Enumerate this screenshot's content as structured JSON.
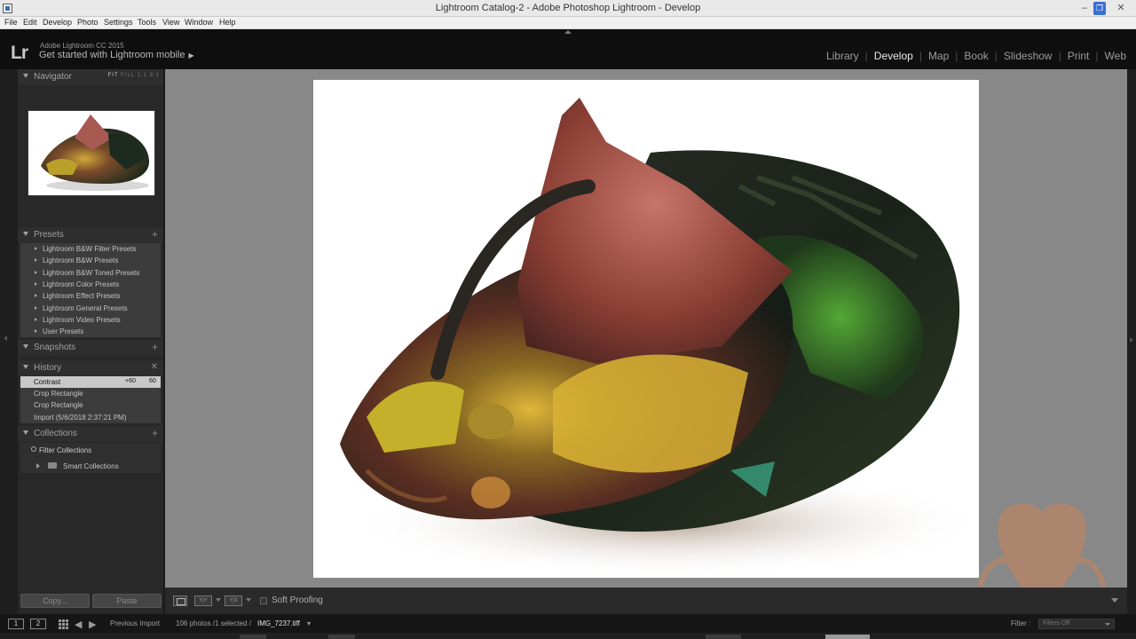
{
  "window": {
    "title": "Lightroom Catalog-2 - Adobe Photoshop Lightroom - Develop",
    "minimize": "–",
    "maximize": "❐",
    "close": "✕"
  },
  "menu": [
    "File",
    "Edit",
    "Develop",
    "Photo",
    "Settings",
    "Tools",
    "View",
    "Window",
    "Help"
  ],
  "identity": {
    "logo": "Lr",
    "version": "Adobe Lightroom CC 2015",
    "mobile_prompt": "Get started with Lightroom mobile",
    "mobile_arrow": "▶"
  },
  "modules": [
    {
      "label": "Library",
      "active": false
    },
    {
      "label": "Develop",
      "active": true
    },
    {
      "label": "Map",
      "active": false
    },
    {
      "label": "Book",
      "active": false
    },
    {
      "label": "Slideshow",
      "active": false
    },
    {
      "label": "Print",
      "active": false
    },
    {
      "label": "Web",
      "active": false
    }
  ],
  "navigator": {
    "title": "Navigator",
    "modes": [
      "FIT",
      "FILL",
      "1:1",
      "3:1"
    ],
    "active_mode": "FIT"
  },
  "presets": {
    "title": "Presets",
    "add": "+",
    "items": [
      "Lightroom B&W Filter Presets",
      "Lightroom B&W Presets",
      "Lightroom B&W Toned Presets",
      "Lightroom Color Presets",
      "Lightroom Effect Presets",
      "Lightroom General Presets",
      "Lightroom Video Presets",
      "User Presets"
    ]
  },
  "snapshots": {
    "title": "Snapshots",
    "add": "+"
  },
  "history": {
    "title": "History",
    "clear": "✕",
    "items": [
      {
        "label": "Contrast",
        "v1": "+60",
        "v2": "60",
        "selected": true
      },
      {
        "label": "Crop Rectangle",
        "v1": "",
        "v2": "",
        "selected": false
      },
      {
        "label": "Crop Rectangle",
        "v1": "",
        "v2": "",
        "selected": false
      },
      {
        "label": "Import (5/6/2018 2:37:21 PM)",
        "v1": "",
        "v2": "",
        "selected": false
      }
    ]
  },
  "collections": {
    "title": "Collections",
    "add": "+",
    "filter": "Filter Collections",
    "items": [
      "Smart Collections"
    ]
  },
  "buttons": {
    "copy": "Copy...",
    "paste": "Paste"
  },
  "toolbar": {
    "compare_label": "Y|Y",
    "survey_label": "Y|X",
    "soft_proofing": "Soft Proofing"
  },
  "filmstrip": {
    "window1": "1",
    "window2": "2",
    "source": "Previous Import",
    "count": "106 photos /1 selected /",
    "file": "IMG_7237.tiff",
    "file_caret": "▾",
    "filter_label": "Filter :",
    "filter_value": "Filters Off"
  },
  "colors": {
    "canvas": "#888888",
    "panel": "#282828",
    "active_module": "#e8e8e8",
    "accent_window": "#3b6fd1"
  },
  "icons": {
    "loupe": "loupe-view-icon",
    "compare": "compare-view-icon",
    "survey": "survey-view-icon",
    "grid": "grid-view-icon",
    "search": "search-icon",
    "folder": "folder-icon"
  }
}
